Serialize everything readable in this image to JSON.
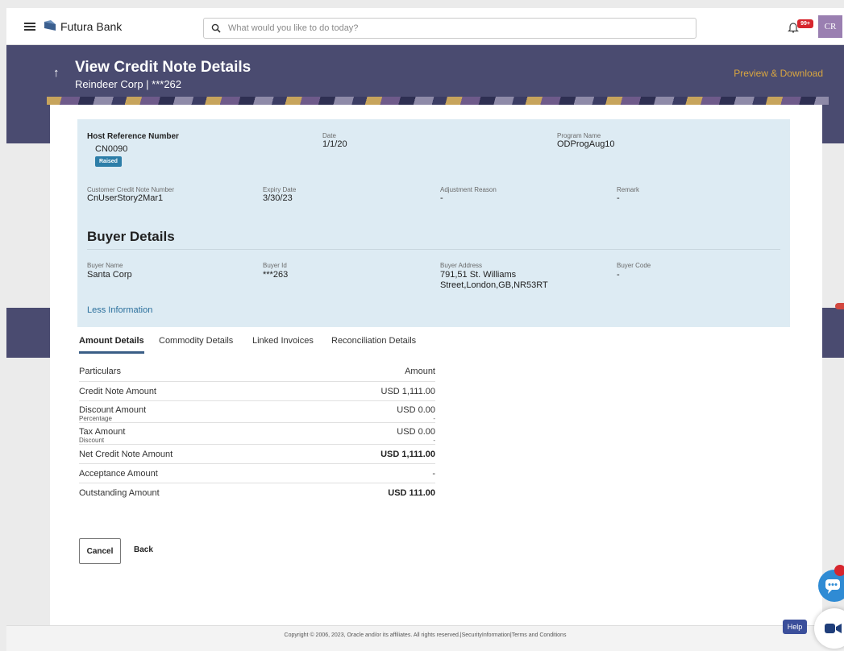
{
  "app": {
    "brand": "Futura Bank",
    "search_placeholder": "What would you like to do today?",
    "notifications_badge": "99+",
    "avatar_initials": "CR"
  },
  "header": {
    "title": "View Credit Note Details",
    "subtitle": "Reindeer Corp | ***262",
    "preview_link": "Preview & Download"
  },
  "details": {
    "host_ref_label": "Host Reference Number",
    "host_ref_value": "CN0090",
    "status": "Raised",
    "date_label": "Date",
    "date_value": "1/1/20",
    "program_label": "Program Name",
    "program_value": "ODProgAug10",
    "cust_cn_label": "Customer Credit Note Number",
    "cust_cn_value": "CnUserStory2Mar1",
    "expiry_label": "Expiry Date",
    "expiry_value": "3/30/23",
    "adjust_label": "Adjustment Reason",
    "adjust_value": "-",
    "remark_label": "Remark",
    "remark_value": "-"
  },
  "buyer": {
    "section_title": "Buyer Details",
    "name_label": "Buyer Name",
    "name_value": "Santa Corp",
    "id_label": "Buyer Id",
    "id_value": "***263",
    "address_label": "Buyer Address",
    "address_line1": "791,51 St. Williams",
    "address_line2": "Street,London,GB,NR53RT",
    "code_label": "Buyer Code",
    "code_value": "-",
    "less_info": "Less Information"
  },
  "tabs": [
    "Amount Details",
    "Commodity Details",
    "Linked Invoices",
    "Reconciliation Details"
  ],
  "amounts": {
    "header_particulars": "Particulars",
    "header_amount": "Amount",
    "rows": [
      {
        "label": "Credit Note Amount",
        "value": "USD 1,111.00"
      },
      {
        "label": "Discount Amount",
        "sub": "Percentage",
        "value": "USD 0.00",
        "sub_value": "-"
      },
      {
        "label": "Tax Amount",
        "sub": "Discount",
        "value": "USD 0.00",
        "sub_value": "-"
      },
      {
        "label": "Net Credit Note Amount",
        "value": "USD 1,111.00"
      },
      {
        "label": "Acceptance Amount",
        "value": "-"
      },
      {
        "label": "Outstanding Amount",
        "value": "USD 111.00"
      }
    ]
  },
  "actions": {
    "cancel": "Cancel",
    "back": "Back"
  },
  "footer": {
    "copyright": "Copyright © 2006, 2023, Oracle and/or its affiliates. All rights reserved.|SecurityInformation|Terms and Conditions"
  },
  "floating": {
    "help": "Help"
  },
  "colors": {
    "banner": "#4a4b70",
    "accent_link": "#d9a640",
    "info_panel": "#ddebf3",
    "status_pill": "#2d7ea8",
    "tab_underline": "#3a5e86"
  }
}
